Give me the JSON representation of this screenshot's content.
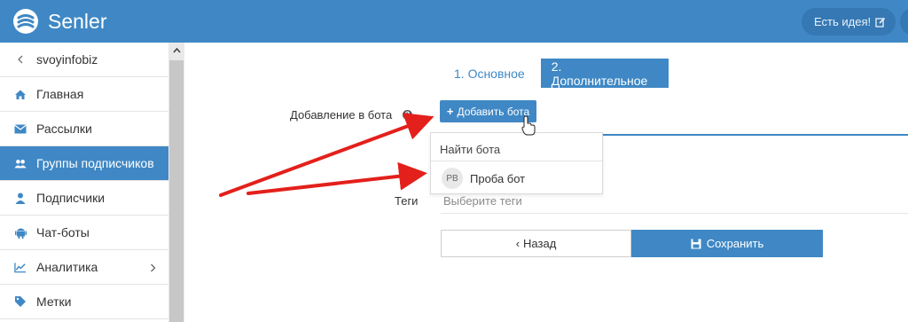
{
  "app": {
    "name": "Senler",
    "brand_color": "#3f88c5"
  },
  "header": {
    "idea_label": "Есть идея!"
  },
  "sidebar": {
    "back_label": "svoyinfobiz",
    "items": [
      {
        "label": "Главная",
        "icon": "home-icon"
      },
      {
        "label": "Рассылки",
        "icon": "envelope-icon"
      },
      {
        "label": "Группы подписчиков",
        "icon": "users-icon",
        "active": true
      },
      {
        "label": "Подписчики",
        "icon": "user-icon"
      },
      {
        "label": "Чат-боты",
        "icon": "android-icon"
      },
      {
        "label": "Аналитика",
        "icon": "line-chart-icon",
        "has_submenu": true
      },
      {
        "label": "Метки",
        "icon": "tag-icon"
      }
    ]
  },
  "tabs": [
    {
      "label": "1. Основное",
      "active": false
    },
    {
      "label": "2. Дополнительное",
      "active": true
    }
  ],
  "form": {
    "add_to_bot_label": "Добавление в бота",
    "add_bot_button": "Добавить бота",
    "dropdown": {
      "search_placeholder": "Найти бота",
      "options": [
        {
          "initials": "PB",
          "name": "Проба бот"
        }
      ]
    },
    "tags_label": "Теги",
    "tags_placeholder": "Выберите теги",
    "back_button": "Назад",
    "save_button": "Сохранить"
  }
}
